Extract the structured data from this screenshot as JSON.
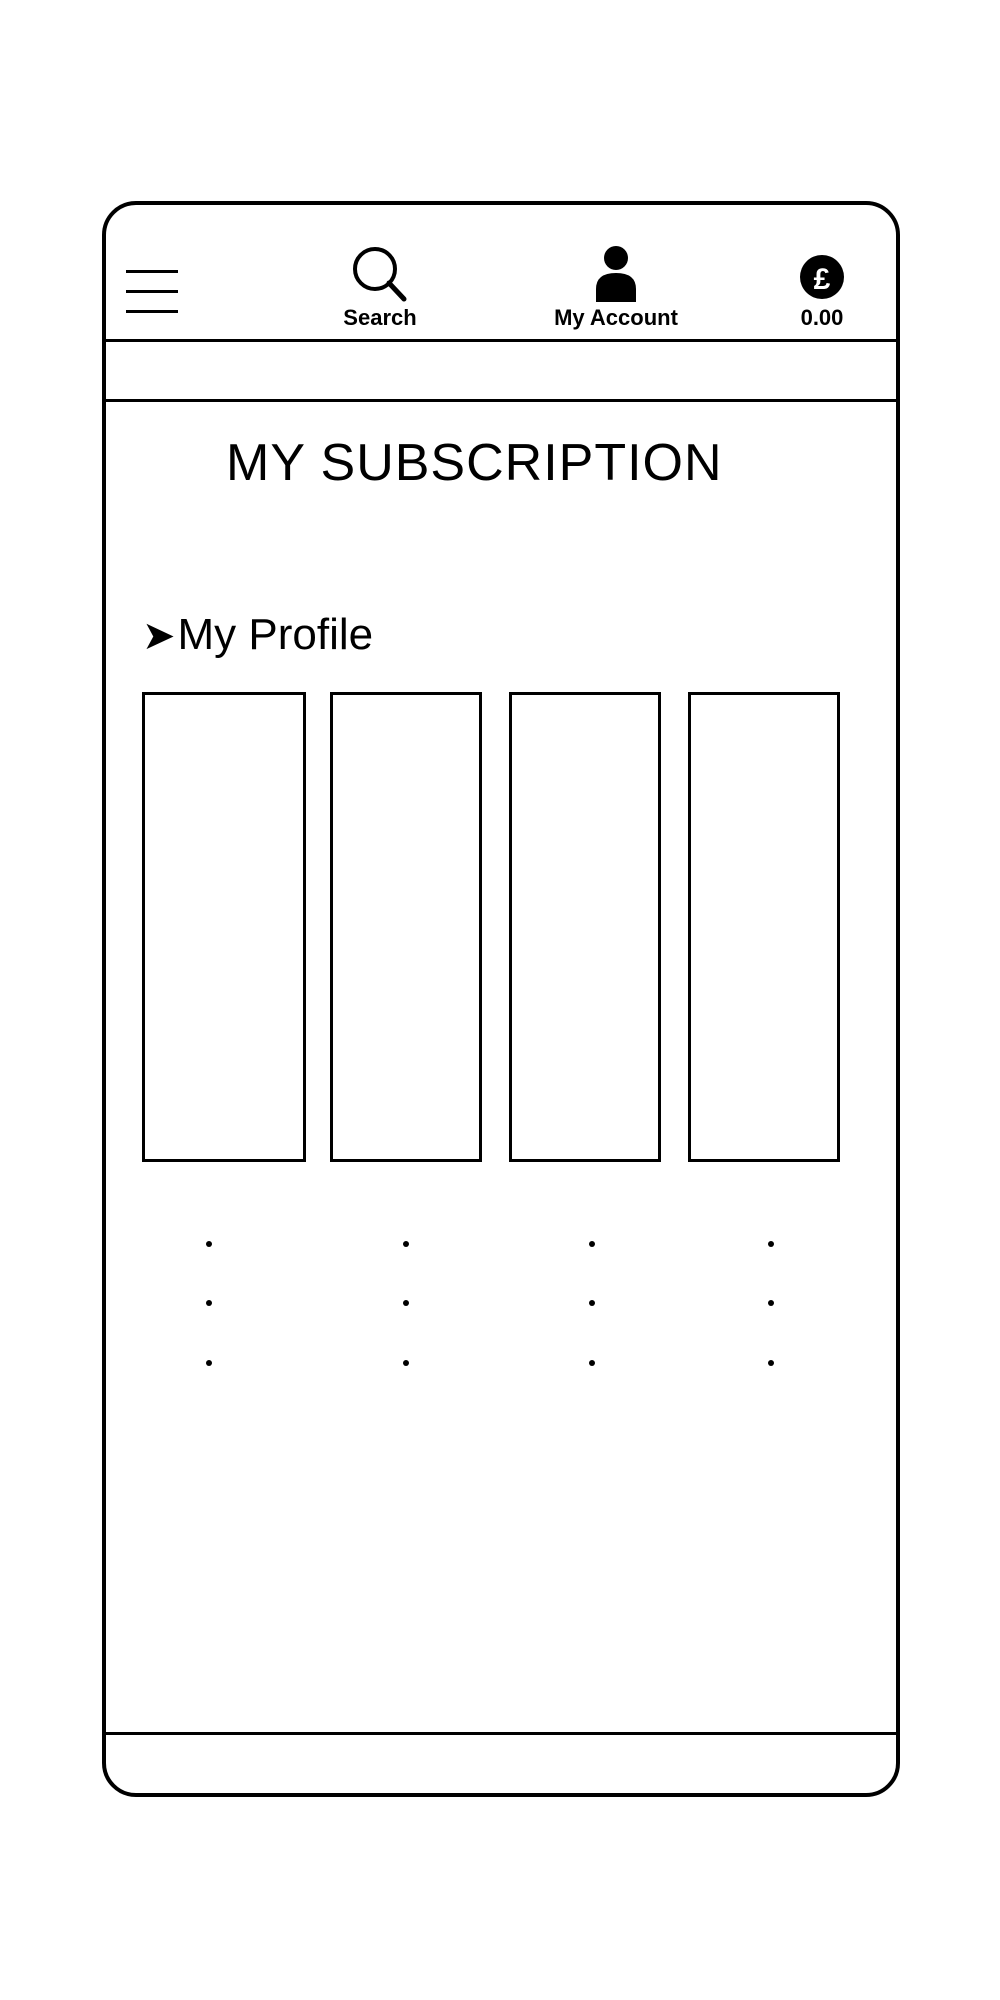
{
  "header": {
    "menu_icon": "hamburger-menu-icon",
    "search": {
      "icon": "search-icon",
      "label": "Search"
    },
    "account": {
      "icon": "person-icon",
      "label": "My Account"
    },
    "basket": {
      "icon": "pound-coin-icon",
      "label": "0.00"
    }
  },
  "page": {
    "title": "MY SUBSCRIPTION"
  },
  "profile_section": {
    "icon": "arrow-right-icon",
    "label": "My Profile"
  },
  "cards": [
    {
      "name": "subscription-card-1"
    },
    {
      "name": "subscription-card-2"
    },
    {
      "name": "subscription-card-3"
    },
    {
      "name": "subscription-card-4"
    }
  ]
}
